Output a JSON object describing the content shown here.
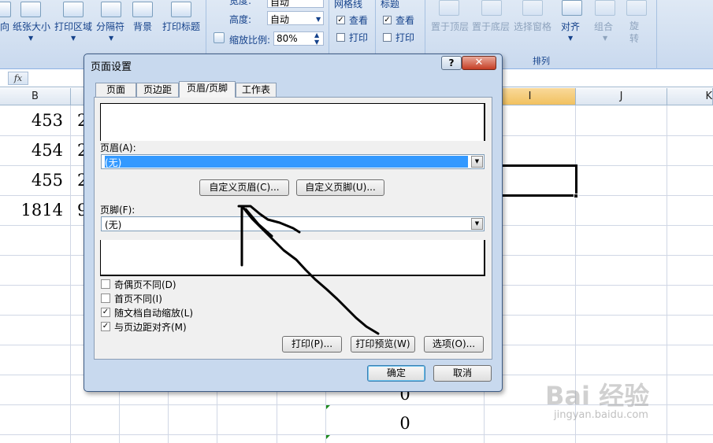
{
  "ribbon": {
    "buttons": {
      "orientation": "向",
      "paper_size": "纸张大小",
      "print_area": "打印区域",
      "breaks": "分隔符",
      "background": "背景",
      "print_titles": "打印标题"
    },
    "page_setup_label": "页面设置",
    "scale": {
      "width_label": "宽度:",
      "width_value": "自动",
      "height_label": "高度:",
      "height_value": "自动",
      "zoom_label": "缩放比例:",
      "zoom_value": "80%"
    },
    "gridlines": {
      "title": "网格线",
      "view_label": "查看",
      "view_checked": true,
      "print_label": "打印",
      "print_checked": false
    },
    "headings": {
      "title": "标题",
      "view_label": "查看",
      "view_checked": true,
      "print_label": "打印",
      "print_checked": false
    },
    "arrange": {
      "bring_front": "置于顶层",
      "send_back": "置于底层",
      "selection_pane": "选择窗格",
      "align": "对齐",
      "group": "组合",
      "rotate": "旋转",
      "label": "排列"
    }
  },
  "formula_bar": {
    "fx_label": "fx"
  },
  "sheet": {
    "columns": [
      "B",
      "I",
      "J",
      "K"
    ],
    "selected_column": "I",
    "b_values": [
      "453",
      "454",
      "455",
      "1814"
    ],
    "c_partial": [
      "2",
      "2",
      "2",
      "9"
    ],
    "zeros": [
      "0",
      "0"
    ]
  },
  "dialog": {
    "title": "页面设置",
    "help_label": "?",
    "close_label": "✕",
    "tabs": [
      "页面",
      "页边距",
      "页眉/页脚",
      "工作表"
    ],
    "active_tab": "页眉/页脚",
    "header_label": "页眉(A):",
    "header_value": "(无)",
    "custom_header_button": "自定义页眉(C)...",
    "custom_footer_button": "自定义页脚(U)...",
    "footer_label": "页脚(F):",
    "footer_value": "(无)",
    "options": [
      {
        "label": "奇偶页不同(D)",
        "checked": false
      },
      {
        "label": "首页不同(I)",
        "checked": false
      },
      {
        "label": "随文档自动缩放(L)",
        "checked": true
      },
      {
        "label": "与页边距对齐(M)",
        "checked": true
      }
    ],
    "print_button": "打印(P)...",
    "print_preview_button": "打印预览(W)",
    "options_button": "选项(O)...",
    "ok_button": "确定",
    "cancel_button": "取消"
  },
  "watermark": {
    "brand": "Bai 经验",
    "url": "jingyan.baidu.com"
  },
  "icons": [
    "dropdown-arrow-icon",
    "spin-icon",
    "checkmark-icon",
    "help-icon",
    "close-icon",
    "fx-icon"
  ]
}
